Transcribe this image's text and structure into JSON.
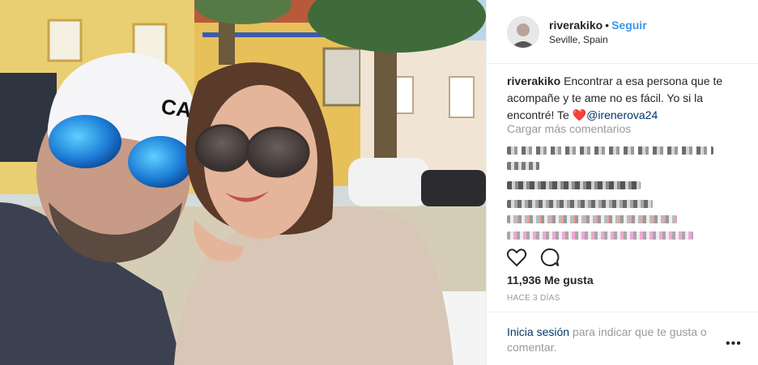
{
  "post": {
    "username": "riverakiko",
    "separator": "•",
    "follow_label": "Seguir",
    "location": "Seville, Spain"
  },
  "caption": {
    "username": "riverakiko",
    "text": "Encontrar a esa persona que te acompañe y te ame no es fácil. Yo si la encontré! Te",
    "emoji": "❤️",
    "mention": "@irenerova24"
  },
  "comments": {
    "load_more_label": "Cargar más comentarios"
  },
  "actions": {
    "like_icon": "heart-outline-icon",
    "comment_icon": "speech-bubble-icon"
  },
  "stats": {
    "likes": "11,936 Me gusta",
    "time_ago": "HACE 3 DÍAS"
  },
  "footer": {
    "login_link": "Inicia sesión",
    "login_text": " para indicar que te gusta o comentar.",
    "more_icon": "•••"
  },
  "colors": {
    "link_blue": "#3897f0",
    "mention_dark": "#003569",
    "muted": "#999999",
    "text": "#262626"
  }
}
